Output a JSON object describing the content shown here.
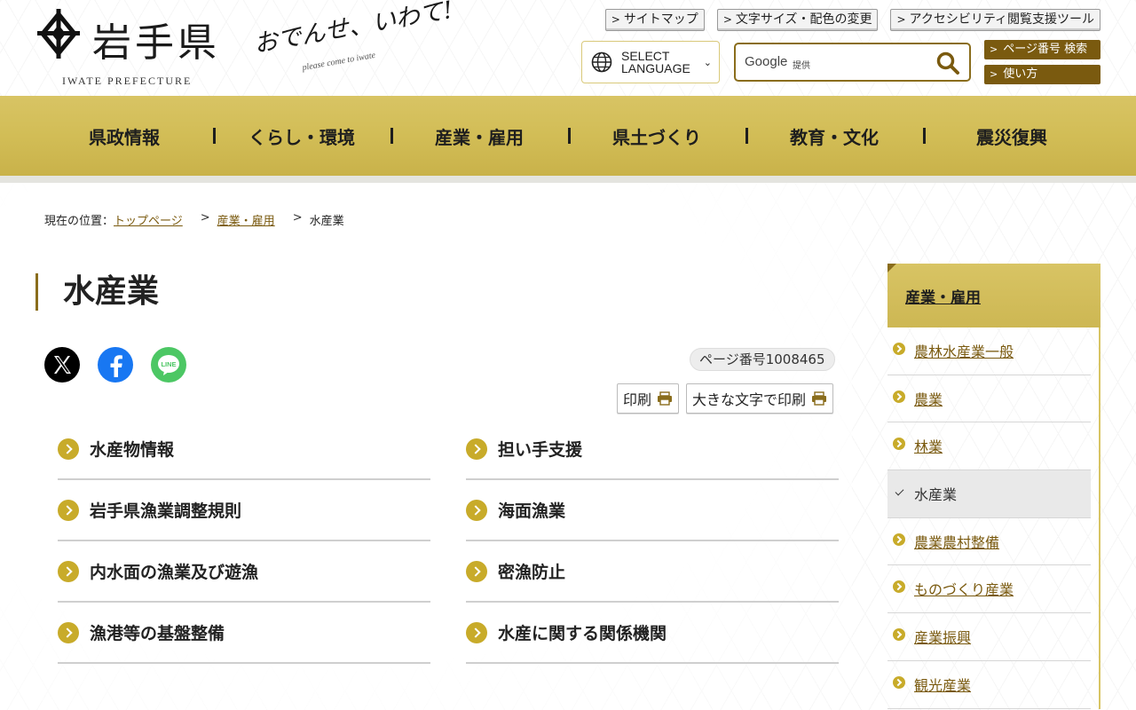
{
  "header": {
    "logo_name": "岩手県",
    "logo_en": "IWATE PREFECTURE",
    "catch_main": "おでんせ、いわて!",
    "catch_sub": "please come to iwate",
    "util_links": [
      "サイトマップ",
      "文字サイズ・配色の変更",
      "アクセシビリティ閲覧支援ツール"
    ],
    "language_button": "SELECT\nLANGUAGE",
    "search": {
      "google": "Google",
      "provided": "提供",
      "placeholder": "",
      "value": ""
    },
    "side_buttons": [
      "ページ番号 検索",
      "使い方"
    ]
  },
  "global_nav": [
    "県政情報",
    "くらし・環境",
    "産業・雇用",
    "県土づくり",
    "教育・文化",
    "震災復興"
  ],
  "breadcrumb": {
    "prefix": "現在の位置：",
    "items": [
      "トップページ",
      "産業・雇用",
      "水産業"
    ]
  },
  "page_title": "水産業",
  "page_number": "ページ番号1008465",
  "print_buttons": [
    "印刷",
    "大きな文字で印刷"
  ],
  "links": [
    [
      "水産物情報",
      "担い手支援"
    ],
    [
      "岩手県漁業調整規則",
      "海面漁業"
    ],
    [
      "内水面の漁業及び遊漁",
      "密漁防止"
    ],
    [
      "漁港等の基盤整備",
      "水産に関する関係機関"
    ]
  ],
  "sidenav": {
    "heading": "産業・雇用",
    "items": [
      "農林水産業一般",
      "農業",
      "林業",
      "水産業",
      "農業農村整備",
      "ものづくり産業",
      "産業振興",
      "観光産業"
    ],
    "current_index": 3
  },
  "share_icons": [
    "x-icon",
    "facebook-icon",
    "line-icon"
  ],
  "colors": {
    "accent_gold": "#d2bd56",
    "dark_gold": "#7a5a0f",
    "bullet": "#c8ab2a"
  }
}
